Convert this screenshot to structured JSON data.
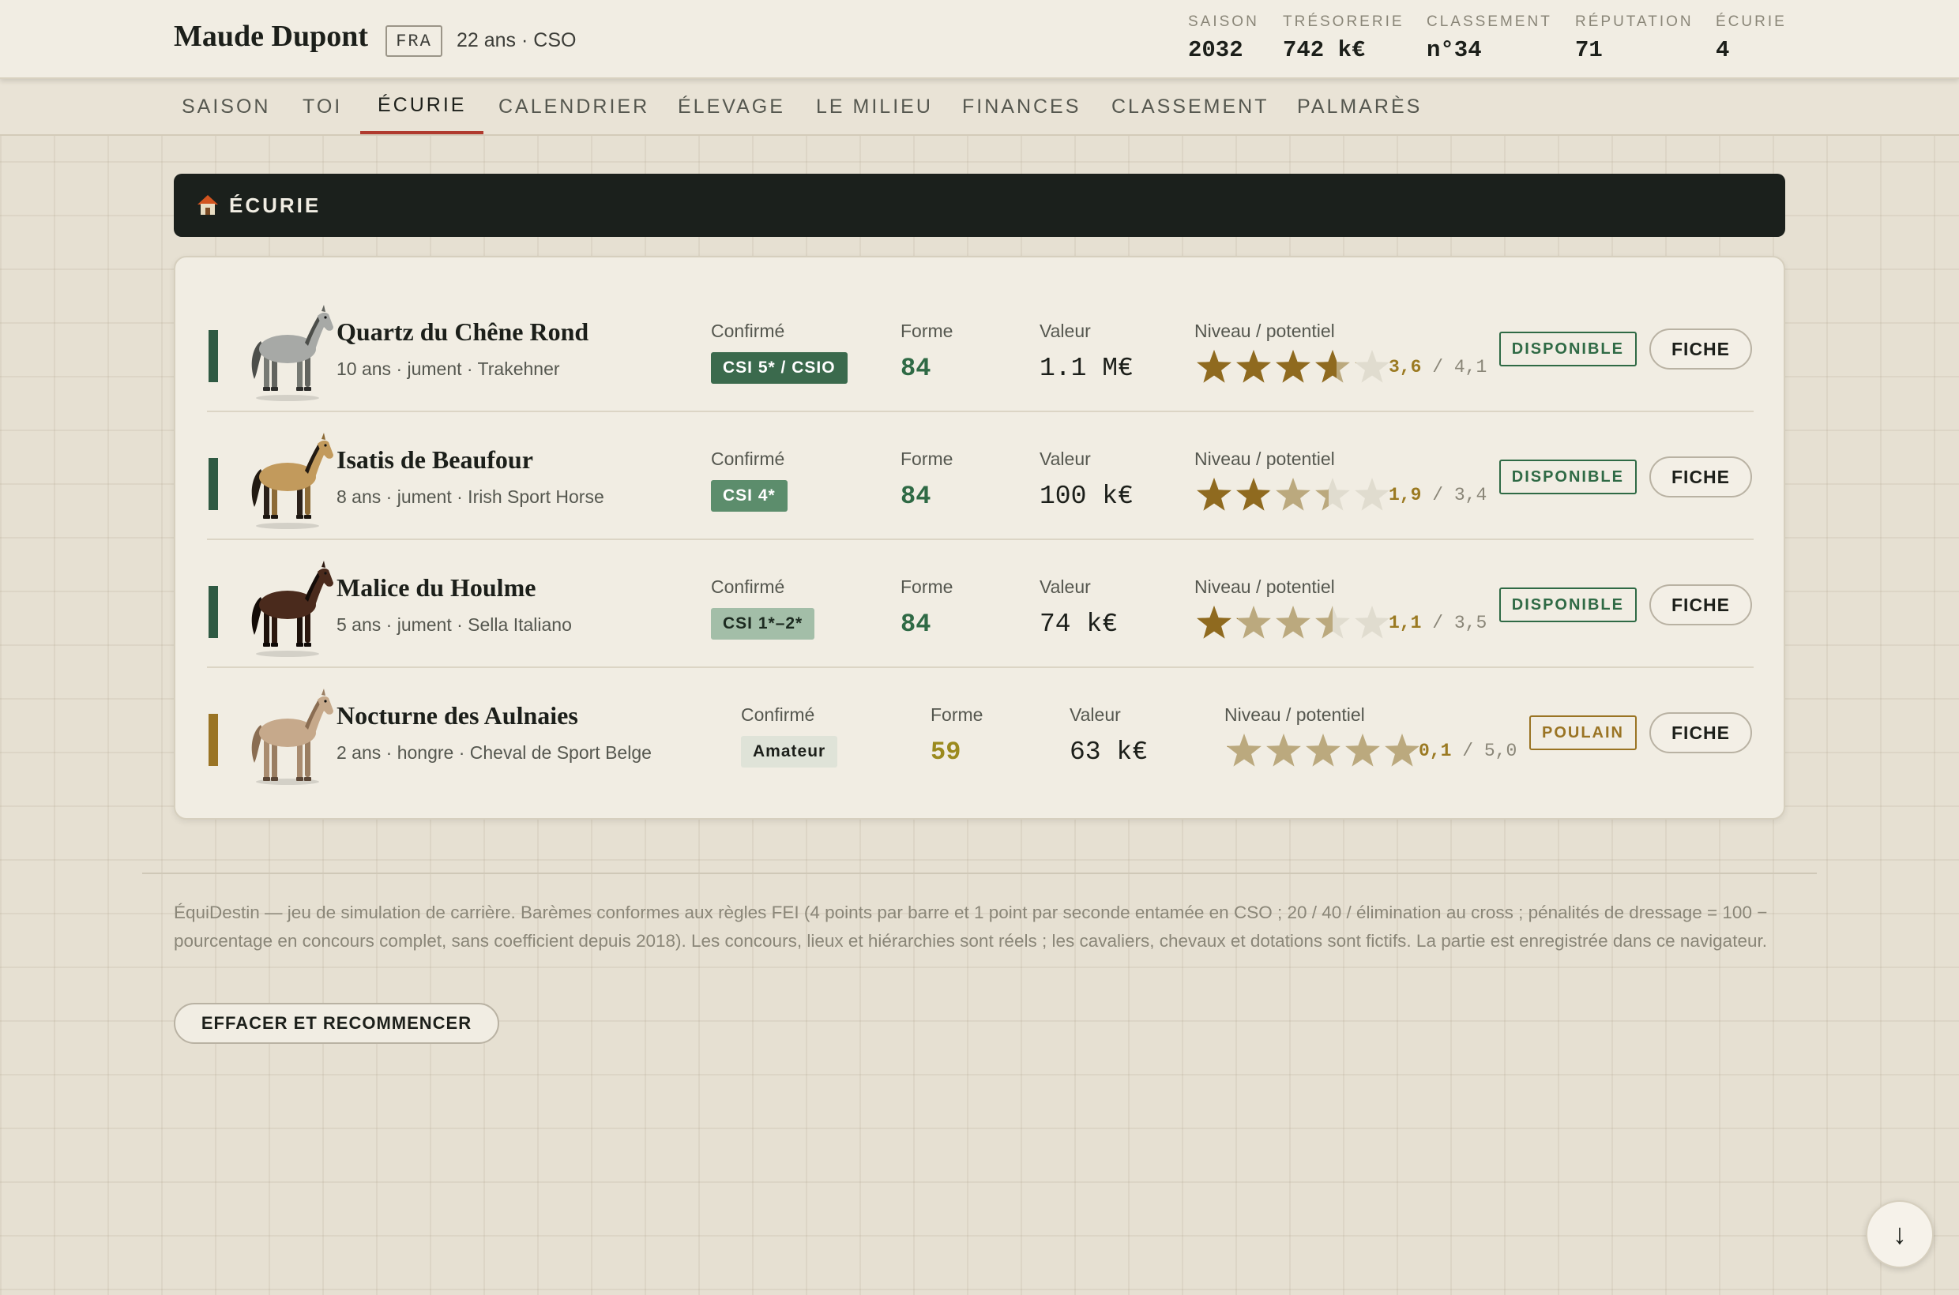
{
  "player": {
    "name": "Maude Dupont",
    "nation": "FRA",
    "meta": "22 ans · CSO"
  },
  "stats": [
    {
      "label": "SAISON",
      "value": "2032"
    },
    {
      "label": "TRÉSORERIE",
      "value": "742 k€"
    },
    {
      "label": "CLASSEMENT",
      "value": "n°34"
    },
    {
      "label": "RÉPUTATION",
      "value": "71"
    },
    {
      "label": "ÉCURIE",
      "value": "4"
    }
  ],
  "nav": {
    "tabs": [
      {
        "label": "SAISON"
      },
      {
        "label": "TOI"
      },
      {
        "label": "ÉCURIE",
        "active": true
      },
      {
        "label": "CALENDRIER"
      },
      {
        "label": "ÉLEVAGE"
      },
      {
        "label": "LE MILIEU"
      },
      {
        "label": "FINANCES"
      },
      {
        "label": "CLASSEMENT"
      },
      {
        "label": "PALMARÈS"
      }
    ]
  },
  "section": {
    "icon": "house-icon",
    "title": "ÉCURIE"
  },
  "horses": [
    {
      "name": "Quartz du Chêne Rond",
      "desc": "10 ans · jument · Trakehner",
      "category_label": "Confirmé",
      "level_badge": "CSI 5* / CSIO",
      "forme_label": "Forme",
      "forme": "84",
      "valeur_label": "Valeur",
      "valeur": "1.1 M€",
      "niveau_label": "Niveau / potentiel",
      "niveau": "3,6",
      "potentiel": "/ 4,1",
      "stars_level": 3.6,
      "stars_potential": 4.1,
      "status": "DISPONIBLE",
      "fiche": "FICHE",
      "coat": "grey",
      "accent_color": "#2f5a43",
      "badge_bg": "#3b6a4d",
      "badge_fg": "#ffffff",
      "forme_color": "#2f6a45",
      "status_color": "#2f6a45"
    },
    {
      "name": "Isatis de Beaufour",
      "desc": "8 ans · jument · Irish Sport Horse",
      "category_label": "Confirmé",
      "level_badge": "CSI 4*",
      "forme_label": "Forme",
      "forme": "84",
      "valeur_label": "Valeur",
      "valeur": "100 k€",
      "niveau_label": "Niveau / potentiel",
      "niveau": "1,9",
      "potentiel": "/ 3,4",
      "stars_level": 1.9,
      "stars_potential": 3.4,
      "status": "DISPONIBLE",
      "fiche": "FICHE",
      "coat": "buckskin",
      "accent_color": "#2f5a43",
      "badge_bg": "#5c8d6c",
      "badge_fg": "#ffffff",
      "forme_color": "#2f6a45",
      "status_color": "#2f6a45"
    },
    {
      "name": "Malice du Houlme",
      "desc": "5 ans · jument · Sella Italiano",
      "category_label": "Confirmé",
      "level_badge": "CSI 1*–2*",
      "forme_label": "Forme",
      "forme": "84",
      "valeur_label": "Valeur",
      "valeur": "74 k€",
      "niveau_label": "Niveau / potentiel",
      "niveau": "1,1",
      "potentiel": "/ 3,5",
      "stars_level": 1.1,
      "stars_potential": 3.5,
      "status": "DISPONIBLE",
      "fiche": "FICHE",
      "coat": "darkbay",
      "accent_color": "#2f5a43",
      "badge_bg": "#a3bea8",
      "badge_fg": "#1c2a20",
      "forme_color": "#2f6a45",
      "status_color": "#2f6a45"
    },
    {
      "name": "Nocturne des Aulnaies",
      "desc": "2 ans · hongre · Cheval de Sport Belge",
      "category_label": "Confirmé",
      "level_badge": "Amateur",
      "forme_label": "Forme",
      "forme": "59",
      "valeur_label": "Valeur",
      "valeur": "63 k€",
      "niveau_label": "Niveau / potentiel",
      "niveau": "0,1",
      "potentiel": "/ 5,0",
      "stars_level": 0.1,
      "stars_potential": 5.0,
      "status": "POULAIN",
      "fiche": "FICHE",
      "coat": "foal",
      "accent_color": "#9a7424",
      "badge_bg": "#dfe3d8",
      "badge_fg": "#1c1f1a",
      "forme_color": "#9b8a1d",
      "status_color": "#9a7424"
    }
  ],
  "star_colors": {
    "level": "#8f6a1f",
    "potential": "#bba97e",
    "empty": "#e0dccf"
  },
  "footer": {
    "text": "ÉquiDestin — jeu de simulation de carrière. Barèmes conformes aux règles FEI (4 points par barre et 1 point par seconde entamée en CSO ; 20 / 40 / élimination au cross ; pénalités de dressage = 100 − pourcentage en concours complet, sans coefficient depuis 2018). Les concours, lieux et hiérarchies sont réels ; les cavaliers, chevaux et dotations sont fictifs. La partie est enregistrée dans ce navigateur.",
    "reset_label": "EFFACER ET RECOMMENCER"
  },
  "scroll_button": {
    "icon": "arrow-down-icon",
    "glyph": "↓"
  }
}
